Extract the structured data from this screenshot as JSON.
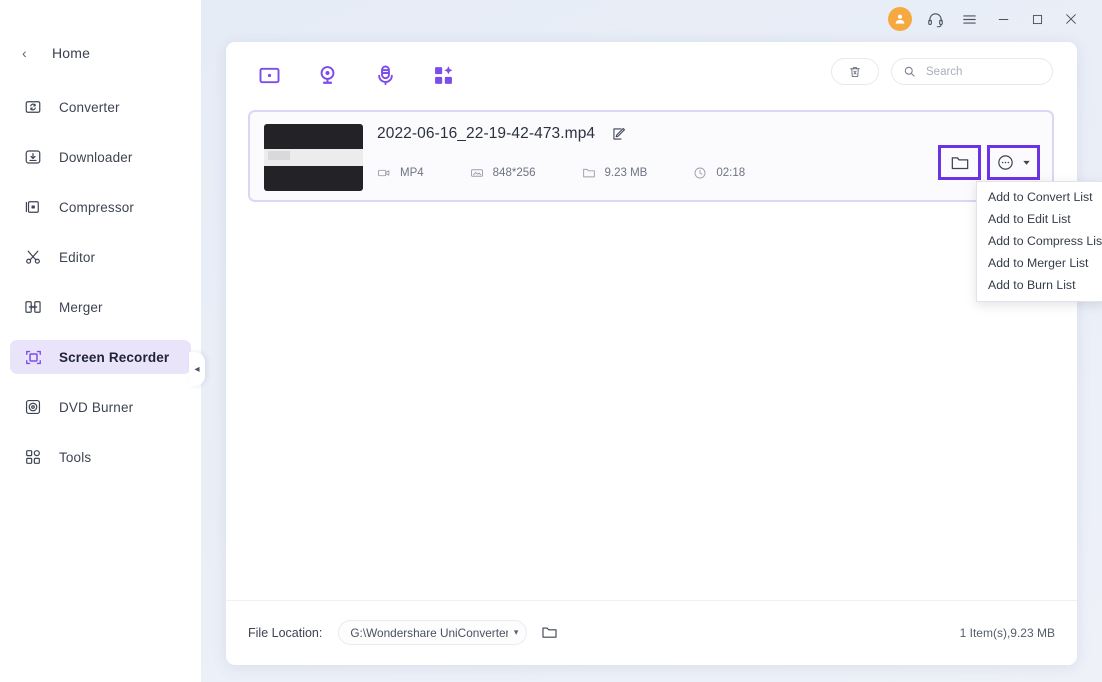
{
  "window": {
    "controls": [
      {
        "name": "avatar",
        "label": "account-avatar"
      },
      {
        "name": "support-icon",
        "label": "support"
      },
      {
        "name": "menu-icon",
        "label": "menu"
      },
      {
        "name": "minimize-button",
        "label": "minimize"
      },
      {
        "name": "maximize-button",
        "label": "maximize"
      },
      {
        "name": "close-button",
        "label": "close"
      }
    ]
  },
  "sidebar": {
    "back_label": "Home",
    "back_chevron": "‹",
    "items": [
      {
        "label": "Converter",
        "icon": "converter-icon",
        "active": false
      },
      {
        "label": "Downloader",
        "icon": "downloader-icon",
        "active": false
      },
      {
        "label": "Compressor",
        "icon": "compressor-icon",
        "active": false
      },
      {
        "label": "Editor",
        "icon": "editor-icon",
        "active": false
      },
      {
        "label": "Merger",
        "icon": "merger-icon",
        "active": false
      },
      {
        "label": "Screen Recorder",
        "icon": "screen-recorder-icon",
        "active": true
      },
      {
        "label": "DVD Burner",
        "icon": "dvd-burner-icon",
        "active": false
      },
      {
        "label": "Tools",
        "icon": "tools-icon",
        "active": false
      }
    ],
    "collapse_chevron": "◂",
    "active_color": "#7c4dea",
    "active_bg": "#eae4fb"
  },
  "toolbar": {
    "buttons": [
      {
        "name": "record-screen-icon",
        "label": "Record Screen"
      },
      {
        "name": "record-webcam-icon",
        "label": "Record Webcam"
      },
      {
        "name": "record-audio-icon",
        "label": "Record Audio"
      },
      {
        "name": "more-tools-icon",
        "label": "More Tools"
      }
    ],
    "accent_color": "#7c4dea"
  },
  "search": {
    "placeholder": "Search",
    "value": "",
    "icon": "search-icon"
  },
  "delete": {
    "icon": "trash-icon",
    "label": "Delete"
  },
  "file": {
    "name": "2022-06-16_22-19-42-473.mp4",
    "edit_icon": "edit-icon",
    "thumbnail": "video-thumbnail",
    "meta": [
      {
        "icon": "format-icon",
        "value": "MP4"
      },
      {
        "icon": "resolution-icon",
        "value": "848*256"
      },
      {
        "icon": "filesize-icon",
        "value": "9.23 MB"
      },
      {
        "icon": "duration-icon",
        "value": "02:18"
      }
    ],
    "actions": [
      {
        "name": "open-folder-button",
        "icon": "folder-icon",
        "highlighted": true
      },
      {
        "name": "add-to-list-button",
        "icon": "more-circle-icon",
        "highlighted": true
      }
    ],
    "highlight_color": "#6a33e4",
    "card_border": "#ded4f5"
  },
  "dropdown": {
    "items": [
      "Add to Convert List",
      "Add to Edit List",
      "Add to Compress List",
      "Add to Merger List",
      "Add to Burn List"
    ]
  },
  "footer": {
    "location_label": "File Location:",
    "location_path": "G:\\Wondershare UniConverter ",
    "caret": "▾",
    "folder_icon": "folder-icon",
    "summary": "1 Item(s),9.23 MB"
  }
}
